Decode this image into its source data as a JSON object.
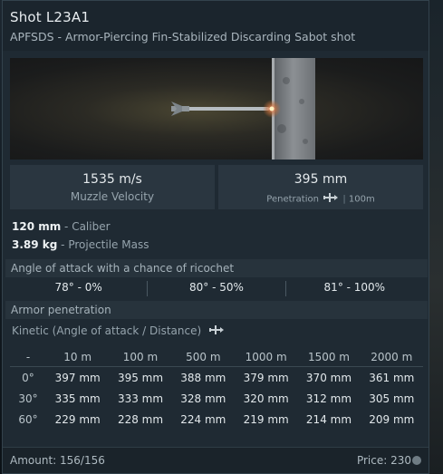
{
  "header": {
    "title": "Shot L23A1",
    "subtitle": "APFSDS - Armor-Piercing Fin-Stabilized Discarding Sabot shot"
  },
  "preview": {
    "icon": "projectile-preview-image"
  },
  "stats": {
    "velocity": {
      "value": "1535 m/s",
      "label": "Muzzle Velocity"
    },
    "penetration": {
      "value": "395 mm",
      "label": "Penetration",
      "distance": "100m"
    }
  },
  "specs": [
    {
      "value": "120 mm",
      "label": "Caliber"
    },
    {
      "value": "3.89 kg",
      "label": "Projectile Mass"
    }
  ],
  "ricochet": {
    "title": "Angle of attack with a chance of ricochet",
    "entries": [
      "78° - 0%",
      "80° - 50%",
      "81° - 100%"
    ]
  },
  "armor": {
    "title": "Armor penetration",
    "kinetic_label": "Kinetic (Angle of attack / Distance)",
    "columns": [
      "-",
      "10 m",
      "100 m",
      "500 m",
      "1000 m",
      "1500 m",
      "2000 m"
    ],
    "rows": [
      {
        "angle": "0°",
        "values": [
          "397 mm",
          "395 mm",
          "388 mm",
          "379 mm",
          "370 mm",
          "361 mm"
        ]
      },
      {
        "angle": "30°",
        "values": [
          "335 mm",
          "333 mm",
          "328 mm",
          "320 mm",
          "312 mm",
          "305 mm"
        ]
      },
      {
        "angle": "60°",
        "values": [
          "229 mm",
          "228 mm",
          "224 mm",
          "219 mm",
          "214 mm",
          "209 mm"
        ]
      }
    ]
  },
  "footer": {
    "amount": "Amount: 156/156",
    "price": "Price: 230"
  }
}
